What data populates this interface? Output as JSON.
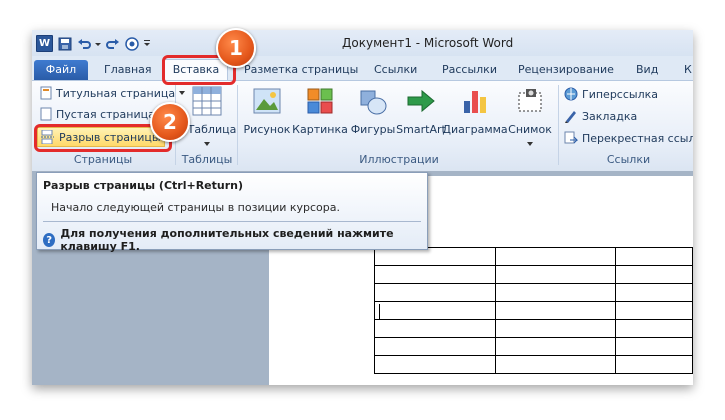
{
  "window": {
    "title": "Документ1 - Microsoft Word"
  },
  "tabs": {
    "file": "Файл",
    "home": "Главная",
    "insert": "Вставка",
    "page_layout": "Разметка страницы",
    "references": "Ссылки",
    "mailings": "Рассылки",
    "review": "Рецензирование",
    "view": "Вид",
    "more": "К"
  },
  "ribbon": {
    "pages": {
      "title_page": "Титульная страница",
      "blank_page": "Пустая страница",
      "page_break": "Разрыв страницы",
      "group": "Страницы"
    },
    "tables": {
      "table": "Таблица",
      "group": "Таблицы"
    },
    "illustrations": {
      "picture": "Рисунок",
      "clipart": "Картинка",
      "shapes": "Фигуры",
      "smartart": "SmartArt",
      "chart": "Диаграмма",
      "screenshot": "Снимок",
      "group": "Иллюстрации"
    },
    "links": {
      "hyperlink": "Гиперссылка",
      "bookmark": "Закладка",
      "cross_ref": "Перекрестная ссылк",
      "group": "Ссылки"
    }
  },
  "tooltip": {
    "title": "Разрыв страницы (Ctrl+Return)",
    "description": "Начало следующей страницы в позиции курсора.",
    "help": "Для получения дополнительных сведений нажмите клавишу F1."
  },
  "callouts": {
    "one": "1",
    "two": "2"
  },
  "colors": {
    "accent": "#2b579a",
    "highlight": "#e32b2b",
    "badge": "#e4571b"
  }
}
